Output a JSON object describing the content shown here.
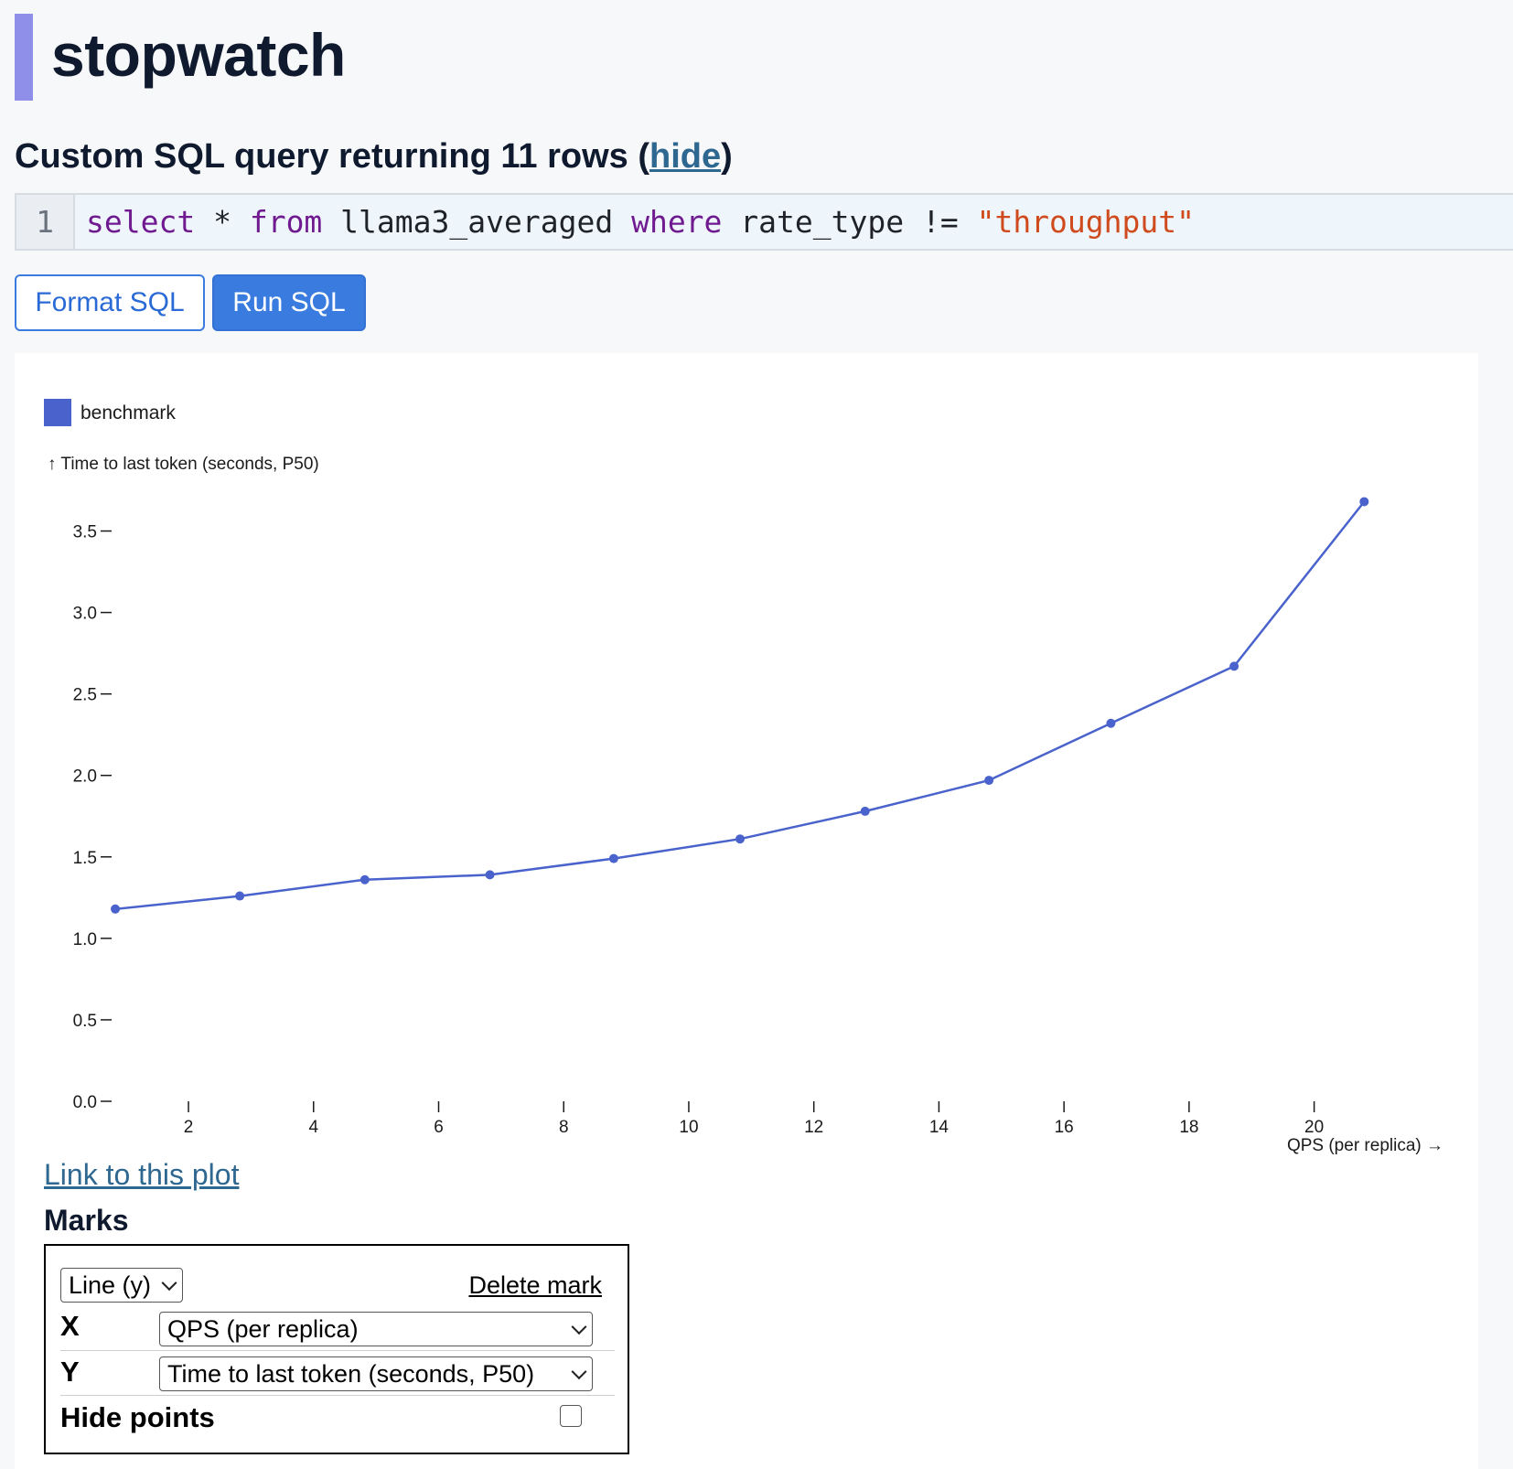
{
  "app": {
    "title": "stopwatch"
  },
  "query": {
    "heading_prefix": "Custom SQL query returning 11 rows (",
    "hide_label": "hide",
    "heading_suffix": ")",
    "line_number": "1",
    "sql_tokens": [
      {
        "t": "select",
        "c": "kw"
      },
      {
        "t": " * ",
        "c": ""
      },
      {
        "t": "from",
        "c": "kw"
      },
      {
        "t": " llama3_averaged ",
        "c": ""
      },
      {
        "t": "where",
        "c": "kw"
      },
      {
        "t": " rate_type != ",
        "c": ""
      },
      {
        "t": "\"throughput\"",
        "c": "str"
      }
    ]
  },
  "buttons": {
    "format": "Format SQL",
    "run": "Run SQL"
  },
  "chart_data": {
    "type": "line",
    "legend": [
      "benchmark"
    ],
    "ylabel": "↑ Time to last token (seconds, P50)",
    "xlabel": "QPS (per replica) →",
    "xlim": [
      0.8,
      21.6
    ],
    "ylim": [
      0,
      3.75
    ],
    "x_ticks": [
      "2",
      "4",
      "6",
      "8",
      "10",
      "12",
      "14",
      "16",
      "18",
      "20"
    ],
    "y_ticks": [
      "0.0",
      "0.5",
      "1.0",
      "1.5",
      "2.0",
      "2.5",
      "3.0",
      "3.5"
    ],
    "series": [
      {
        "name": "benchmark",
        "color": "#4a63cc",
        "x": [
          0.83,
          2.82,
          4.82,
          6.82,
          8.8,
          10.82,
          12.82,
          14.8,
          16.75,
          18.72,
          20.8
        ],
        "y": [
          1.18,
          1.26,
          1.36,
          1.39,
          1.49,
          1.61,
          1.78,
          1.97,
          2.32,
          2.67,
          3.68
        ]
      }
    ]
  },
  "links": {
    "plot_link": "Link to this plot"
  },
  "marks": {
    "heading": "Marks",
    "mark_type": "Line (y)",
    "delete": "Delete mark",
    "x_label": "X",
    "x_value": "QPS (per replica)",
    "y_label": "Y",
    "y_value": "Time to last token (seconds, P50)",
    "hide_points_label": "Hide points",
    "hide_points_checked": false
  }
}
